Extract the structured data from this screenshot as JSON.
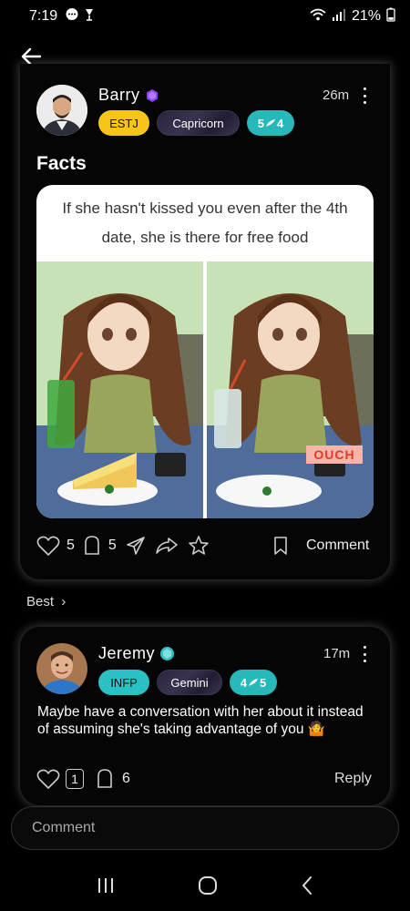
{
  "status_bar": {
    "time": "7:19",
    "battery": "21%"
  },
  "post": {
    "author": "Barry",
    "time_ago": "26m",
    "mbti": "ESTJ",
    "zodiac": "Capricorn",
    "compat_left": "5",
    "compat_right": "4",
    "title": "Facts",
    "meme_caption": "If she hasn't kissed you even after the 4th date, she is there for free food",
    "meme_stamp": "OUCH",
    "likes": "5",
    "comments": "5",
    "comment_label": "Comment"
  },
  "best_label": "Best",
  "top_comment": {
    "author": "Jeremy",
    "time_ago": "17m",
    "mbti": "INFP",
    "zodiac": "Gemini",
    "compat_left": "4",
    "compat_right": "5",
    "text": "Maybe have a conversation with her about it instead of assuming she's taking advantage of you",
    "emoji": "🤷",
    "likes": "1",
    "replies": "6",
    "reply_label": "Reply"
  },
  "comment_input": {
    "placeholder": "Comment"
  },
  "colors": {
    "mbti_yellow": "#f5c518",
    "mbti_teal": "#2bc1c4",
    "compat_teal": "#27b8ba",
    "badge_purple": "#8e44ff"
  }
}
